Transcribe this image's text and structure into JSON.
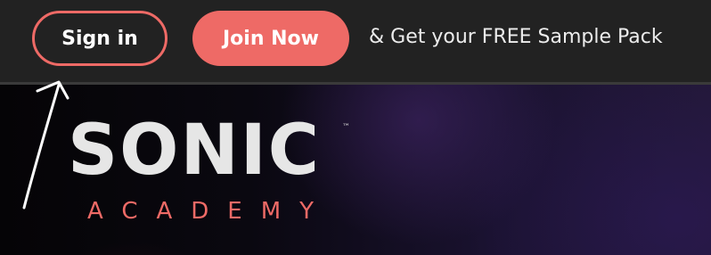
{
  "header": {
    "sign_in_label": "Sign in",
    "join_label": "Join Now",
    "promo_text": "& Get your FREE Sample Pack"
  },
  "logo": {
    "wordmark": "SONIC",
    "trademark": "™",
    "subtitle": "ACADEMY"
  },
  "colors": {
    "accent": "#ee6a66",
    "topbar": "#222222",
    "logo_text": "#e6e6e6"
  },
  "annotation": {
    "icon": "hand-drawn-arrow-icon"
  }
}
